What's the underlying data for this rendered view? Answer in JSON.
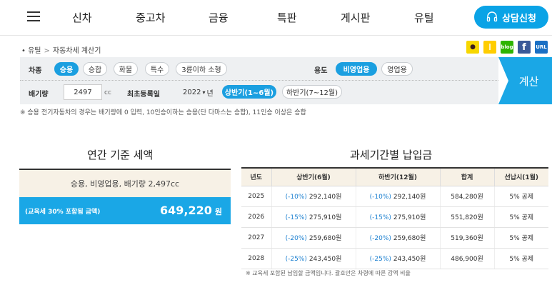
{
  "nav": {
    "menu": [
      "신차",
      "중고차",
      "금융",
      "특판",
      "게시판",
      "유틸"
    ],
    "cta_label": "상담신청"
  },
  "breadcrumb": {
    "items": [
      "유틸",
      "자동차세 계산기"
    ]
  },
  "share": [
    "talk",
    "story",
    "blog",
    "f",
    "URL"
  ],
  "filters": {
    "car_type_label": "차종",
    "car_types": [
      "승용",
      "승합",
      "화물",
      "특수",
      "3륜이하 소형"
    ],
    "car_type_selected": "승용",
    "usage_label": "용도",
    "usages": [
      "비영업용",
      "영업용"
    ],
    "usage_selected": "비영업용",
    "displacement_label": "배기량",
    "displacement_value": "2497",
    "displacement_unit": "cc",
    "first_reg_label": "최초등록일",
    "year_value": "2022",
    "year_suffix": "년",
    "halves": [
      "상반기(1~6월)",
      "하반기(7~12월)"
    ],
    "half_selected": "상반기(1~6월)",
    "calc_button": "계산"
  },
  "notice": "※ 승용 전기자동차의 경우는 배기량에 0 입력, 10인승이하는 승용(단 다마스는 승합), 11인승 이상은 승합",
  "annual": {
    "title": "연간 기준 세액",
    "summary": "승용, 비영업용, 배기량 2,497cc",
    "amount_label": "(교육세 30% 포함됨 금액)",
    "amount": "649,220",
    "amount_unit": "원"
  },
  "periodic": {
    "title": "과세기간별 납입금",
    "columns": [
      "년도",
      "상반기(6월)",
      "하반기(12월)",
      "합계",
      "선납시(1월)"
    ],
    "rows": [
      {
        "year": "2025",
        "h1_pct": "(-10%)",
        "h1": "292,140원",
        "h2_pct": "(-10%)",
        "h2": "292,140원",
        "total": "584,280원",
        "prepay": "5% 공제"
      },
      {
        "year": "2026",
        "h1_pct": "(-15%)",
        "h1": "275,910원",
        "h2_pct": "(-15%)",
        "h2": "275,910원",
        "total": "551,820원",
        "prepay": "5% 공제"
      },
      {
        "year": "2027",
        "h1_pct": "(-20%)",
        "h1": "259,680원",
        "h2_pct": "(-20%)",
        "h2": "259,680원",
        "total": "519,360원",
        "prepay": "5% 공제"
      },
      {
        "year": "2028",
        "h1_pct": "(-25%)",
        "h1": "243,450원",
        "h2_pct": "(-25%)",
        "h2": "243,450원",
        "total": "486,900원",
        "prepay": "5% 공제"
      }
    ],
    "footnote": "※ 교육세 포함된 납입할 금액입니다. 괄호안은 차령에 따른 감액 비율"
  }
}
